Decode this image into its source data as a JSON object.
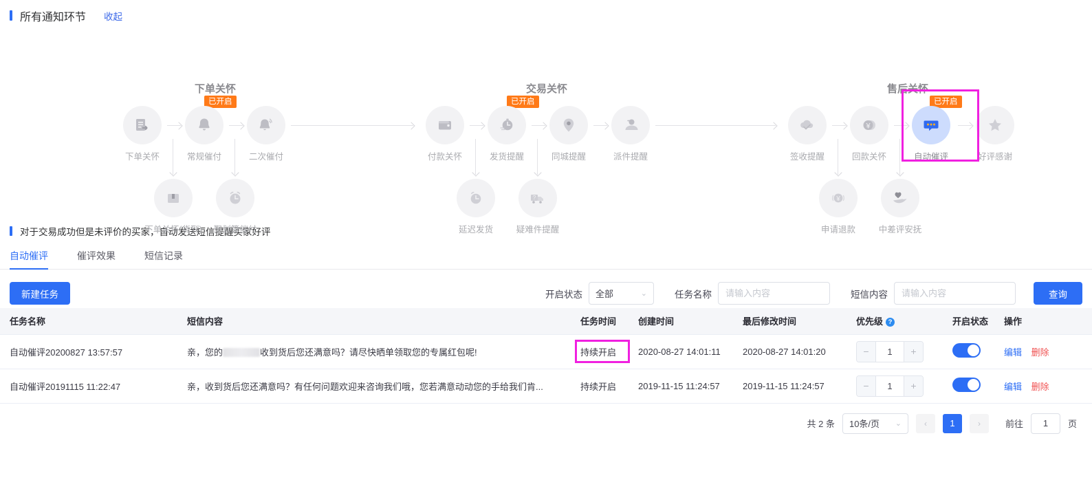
{
  "header": {
    "title": "所有通知环节",
    "collapse_label": "收起"
  },
  "flow": {
    "groups": [
      {
        "title": "下单关怀",
        "badge": "已开启",
        "nodes": [
          {
            "label": "下单关怀",
            "icon": "document-arrow-icon",
            "active": false
          },
          {
            "label": "常规催付",
            "icon": "bell-icon",
            "active": false
          },
          {
            "label": "二次催付",
            "icon": "bell-ring-icon",
            "active": false
          }
        ],
        "sub_nodes": [
          {
            "label": "下单关怀(货到)",
            "icon": "box-icon"
          },
          {
            "label": "聚划算催付",
            "icon": "alarm-clock-icon"
          }
        ]
      },
      {
        "title": "交易关怀",
        "badge": "已开启",
        "nodes": [
          {
            "label": "付款关怀",
            "icon": "wallet-icon",
            "active": false
          },
          {
            "label": "发货提醒",
            "icon": "stopwatch-icon",
            "active": false
          },
          {
            "label": "同城提醒",
            "icon": "location-pin-icon",
            "active": false
          },
          {
            "label": "派件提醒",
            "icon": "courier-person-icon",
            "active": false
          }
        ],
        "sub_nodes": [
          {
            "label": "延迟发货",
            "icon": "clock-icon"
          },
          {
            "label": "疑难件提醒",
            "icon": "question-truck-icon"
          }
        ]
      },
      {
        "title": "售后关怀",
        "badge": "已开启",
        "nodes": [
          {
            "label": "签收提醒",
            "icon": "cloud-check-icon",
            "active": false
          },
          {
            "label": "回款关怀",
            "icon": "yuan-coin-icon",
            "active": false
          },
          {
            "label": "自动催评",
            "icon": "chat-bubble-icon",
            "active": true
          },
          {
            "label": "好评感谢",
            "icon": "star-icon",
            "active": false
          }
        ],
        "sub_nodes": [
          {
            "label": "申请退款",
            "icon": "yuan-refund-icon"
          },
          {
            "label": "中差评安抚",
            "icon": "heart-hand-icon"
          }
        ]
      }
    ]
  },
  "description": "对于交易成功但是未评价的买家，自动发送短信提醒买家好评",
  "tabs": [
    {
      "label": "自动催评",
      "active": true
    },
    {
      "label": "催评效果",
      "active": false
    },
    {
      "label": "短信记录",
      "active": false
    }
  ],
  "toolbar": {
    "new_task_label": "新建任务",
    "status_filter_label": "开启状态",
    "status_filter_value": "全部",
    "task_name_label": "任务名称",
    "task_name_placeholder": "请输入内容",
    "task_name_value": "",
    "sms_content_label": "短信内容",
    "sms_content_placeholder": "请输入内容",
    "sms_content_value": "",
    "query_label": "查询"
  },
  "table": {
    "columns": [
      "任务名称",
      "短信内容",
      "任务时间",
      "创建时间",
      "最后修改时间",
      "优先级",
      "开启状态",
      "操作"
    ],
    "priority_help": "?",
    "rows": [
      {
        "task_name": "自动催评20200827 13:57:57",
        "sms_before": "亲，您的",
        "sms_redacted": true,
        "sms_after": "收到货后您还满意吗？请尽快晒单领取您的专属红包呢!",
        "task_time": "持续开启",
        "task_time_highlighted": true,
        "create_time": "2020-08-27 14:01:11",
        "modify_time": "2020-08-27 14:01:20",
        "priority": "1",
        "enabled": true,
        "edit_label": "编辑",
        "delete_label": "删除"
      },
      {
        "task_name": "自动催评20191115 11:22:47",
        "sms_before": "亲，收到货后您还满意吗？有任何问题欢迎来咨询我们哦，您若满意动动您的手给我们肯...",
        "sms_redacted": false,
        "sms_after": "",
        "task_time": "持续开启",
        "task_time_highlighted": false,
        "create_time": "2019-11-15 11:24:57",
        "modify_time": "2019-11-15 11:24:57",
        "priority": "1",
        "enabled": true,
        "edit_label": "编辑",
        "delete_label": "删除"
      }
    ]
  },
  "pagination": {
    "total_label": "共 2 条",
    "page_size": "10条/页",
    "prev": "‹",
    "next": "›",
    "current_page": "1",
    "goto_label": "前往",
    "goto_value": "1",
    "page_unit": "页"
  },
  "colors": {
    "primary": "#2d6ef5",
    "badge_orange": "#ff7a18",
    "highlight_magenta": "#f020e0",
    "delete_red": "#f05252"
  }
}
